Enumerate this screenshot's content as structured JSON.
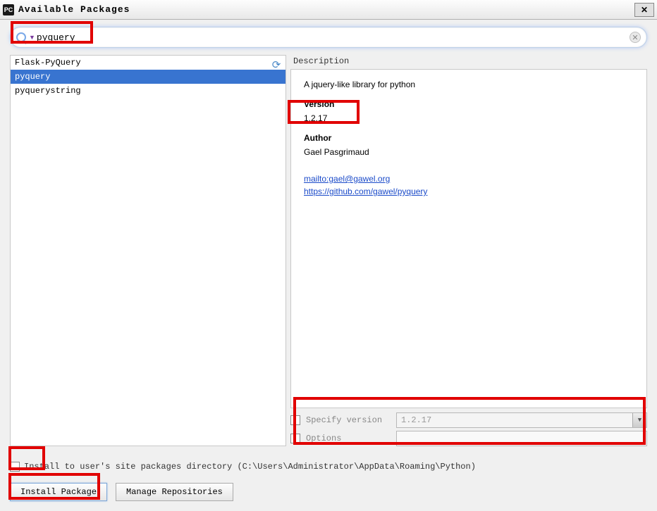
{
  "window": {
    "icon_text": "PC",
    "title": "Available Packages"
  },
  "search": {
    "value": "pyquery"
  },
  "package_list": [
    {
      "name": "Flask-PyQuery",
      "selected": false
    },
    {
      "name": "pyquery",
      "selected": true
    },
    {
      "name": "pyquerystring",
      "selected": false
    }
  ],
  "detail": {
    "section_label": "Description",
    "summary": "A jquery-like library for python",
    "version_heading": "Version",
    "version": "1.2.17",
    "author_heading": "Author",
    "author": "Gael Pasgrimaud",
    "links": [
      "mailto:gael@gawel.org",
      "https://github.com/gawel/pyquery"
    ]
  },
  "options": {
    "specify_version_label": "Specify version",
    "specify_version_value": "1.2.17",
    "options_label": "Options",
    "options_value": ""
  },
  "footer": {
    "site_packages_label": "Install to user's site packages directory (C:\\Users\\Administrator\\AppData\\Roaming\\Python)",
    "install_button": "Install Package",
    "manage_button": "Manage Repositories"
  }
}
